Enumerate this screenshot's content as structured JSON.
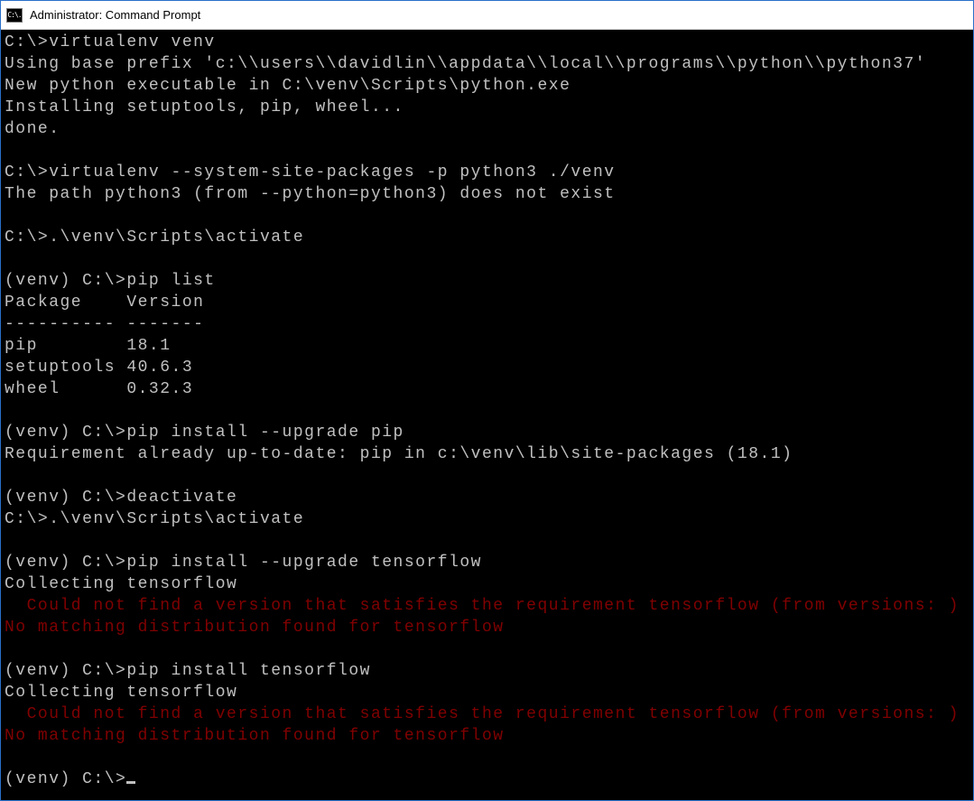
{
  "window": {
    "title": "Administrator: Command Prompt",
    "icon_glyph": "C:\\."
  },
  "terminal": {
    "lines": [
      {
        "text": "C:\\>virtualenv venv",
        "err": false
      },
      {
        "text": "Using base prefix 'c:\\\\users\\\\davidlin\\\\appdata\\\\local\\\\programs\\\\python\\\\python37'",
        "err": false
      },
      {
        "text": "New python executable in C:\\venv\\Scripts\\python.exe",
        "err": false
      },
      {
        "text": "Installing setuptools, pip, wheel...",
        "err": false
      },
      {
        "text": "done.",
        "err": false
      },
      {
        "text": "",
        "err": false
      },
      {
        "text": "C:\\>virtualenv --system-site-packages -p python3 ./venv",
        "err": false
      },
      {
        "text": "The path python3 (from --python=python3) does not exist",
        "err": false
      },
      {
        "text": "",
        "err": false
      },
      {
        "text": "C:\\>.\\venv\\Scripts\\activate",
        "err": false
      },
      {
        "text": "",
        "err": false
      },
      {
        "text": "(venv) C:\\>pip list",
        "err": false
      },
      {
        "text": "Package    Version",
        "err": false
      },
      {
        "text": "---------- -------",
        "err": false
      },
      {
        "text": "pip        18.1",
        "err": false
      },
      {
        "text": "setuptools 40.6.3",
        "err": false
      },
      {
        "text": "wheel      0.32.3",
        "err": false
      },
      {
        "text": "",
        "err": false
      },
      {
        "text": "(venv) C:\\>pip install --upgrade pip",
        "err": false
      },
      {
        "text": "Requirement already up-to-date: pip in c:\\venv\\lib\\site-packages (18.1)",
        "err": false
      },
      {
        "text": "",
        "err": false
      },
      {
        "text": "(venv) C:\\>deactivate",
        "err": false
      },
      {
        "text": "C:\\>.\\venv\\Scripts\\activate",
        "err": false
      },
      {
        "text": "",
        "err": false
      },
      {
        "text": "(venv) C:\\>pip install --upgrade tensorflow",
        "err": false
      },
      {
        "text": "Collecting tensorflow",
        "err": false
      },
      {
        "text": "  Could not find a version that satisfies the requirement tensorflow (from versions: )",
        "err": true
      },
      {
        "text": "No matching distribution found for tensorflow",
        "err": true
      },
      {
        "text": "",
        "err": false
      },
      {
        "text": "(venv) C:\\>pip install tensorflow",
        "err": false
      },
      {
        "text": "Collecting tensorflow",
        "err": false
      },
      {
        "text": "  Could not find a version that satisfies the requirement tensorflow (from versions: )",
        "err": true
      },
      {
        "text": "No matching distribution found for tensorflow",
        "err": true
      },
      {
        "text": "",
        "err": false
      }
    ],
    "prompt": "(venv) C:\\>"
  }
}
